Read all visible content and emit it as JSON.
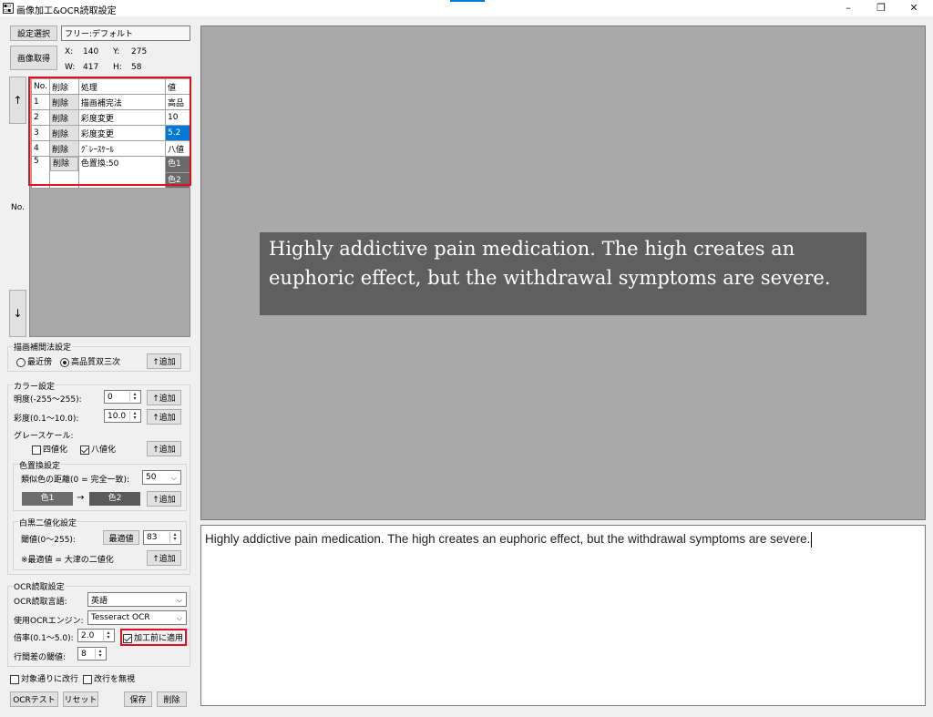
{
  "window": {
    "title": "画像加工&OCR読取設定",
    "icon": "app-icon",
    "controls": [
      "–",
      "❐",
      "✕"
    ]
  },
  "settings": {
    "select_button": "設定選択",
    "preset_value": "フリー:デフォルト",
    "capture_button": "画像取得",
    "x_label": "X:",
    "x_value": "140",
    "y_label": "Y:",
    "y_value": "275",
    "w_label": "W:",
    "w_value": "417",
    "h_label": "H:",
    "h_value": "58"
  },
  "process_table": {
    "headers": [
      "No.",
      "削除",
      "処理",
      "値"
    ],
    "rows": [
      {
        "no": "1",
        "delete": "削除",
        "process": "描画補完法",
        "value": "高品"
      },
      {
        "no": "2",
        "delete": "削除",
        "process": "彩度変更",
        "value": "10"
      },
      {
        "no": "3",
        "delete": "削除",
        "process": "彩度変更",
        "value": "5.2"
      },
      {
        "no": "4",
        "delete": "削除",
        "process": "ｸﾞﾚｰｽｹｰﾙ",
        "value": "八値"
      },
      {
        "no": "5",
        "delete": "削除",
        "process": "色置換:50",
        "value": "色1",
        "value2": "色2"
      }
    ],
    "up_arrow": "↑",
    "down_arrow": "↓",
    "no_label": "No."
  },
  "interpolation": {
    "title": "描画補間法設定",
    "option_nearest": "最近傍",
    "option_bicubic": "高品質双三次",
    "selected": "高品質双三次",
    "add_button": "↑追加"
  },
  "color": {
    "title": "カラー設定",
    "brightness_label": "明度(-255～255):",
    "brightness_value": "0",
    "saturation_label": "彩度(0.1～10.0):",
    "saturation_value": "10.0",
    "grayscale_label": "グレースケール:",
    "gray4_label": "四値化",
    "gray4_checked": false,
    "gray8_label": "八値化",
    "gray8_checked": true,
    "add_button": "↑追加"
  },
  "color_replace": {
    "title": "色置換設定",
    "distance_label": "類似色の距離(0 = 完全一致):",
    "distance_value": "50",
    "color1": "色1",
    "arrow": "→",
    "color2": "色2",
    "color1_hex": "#6d6d6d",
    "color2_hex": "#5a5a5a",
    "add_button": "↑追加"
  },
  "binarize": {
    "title": "白黒二値化設定",
    "threshold_label": "閾値(0～255):",
    "best_button": "最適値",
    "threshold_value": "83",
    "note": "※最適値 = 大津の二値化",
    "add_button": "↑追加"
  },
  "ocr": {
    "title": "OCR読取設定",
    "language_label": "OCR読取言語:",
    "language_value": "英語",
    "engine_label": "使用OCRエンジン:",
    "engine_value": "Tesseract OCR",
    "scale_label": "倍率(0.1～5.0):",
    "scale_value": "2.0",
    "apply_before_label": "加工前に適用",
    "apply_before_checked": true,
    "line_gap_label": "行間差の閾値:",
    "line_gap_value": "8"
  },
  "footer": {
    "wrap_label": "対象通りに改行",
    "wrap_checked": false,
    "ignore_newline_label": "改行を無視",
    "ignore_newline_checked": false,
    "ocr_test_button": "OCRテスト",
    "reset_button": "リセット",
    "save_button": "保存",
    "delete_button": "削除"
  },
  "preview": {
    "line1": "Highly addictive pain medication. The high creates an",
    "line2": "euphoric effect, but the withdrawal symptoms are severe."
  },
  "ocr_result": {
    "text": "Highly addictive pain medication. The high creates an euphoric effect, but the withdrawal symptoms are severe."
  },
  "colors": {
    "highlight_red": "#e01020",
    "selection_blue": "#0078d7",
    "preview_bg": "#a9a9a9",
    "image_bg": "#5f5f5f"
  }
}
